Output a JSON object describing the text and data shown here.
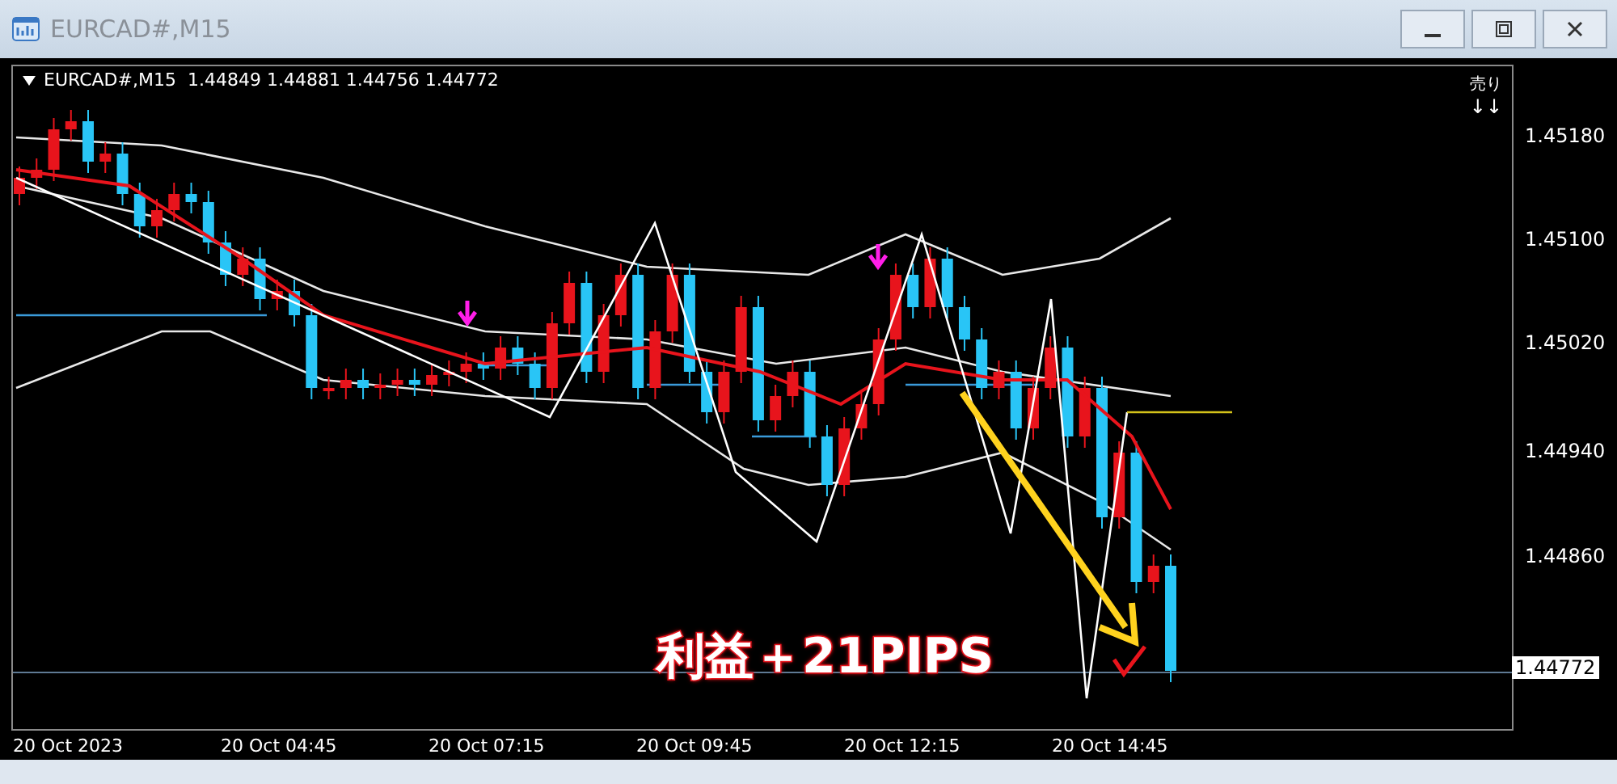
{
  "window": {
    "title": "EURCAD#,M15"
  },
  "chart": {
    "header": "EURCAD#,M15  1.44849 1.44881 1.44756 1.44772",
    "signal": {
      "label": "売り",
      "arrows": "↓↓"
    },
    "annotation": "利益＋21PIPS",
    "price_axis": [
      "1.45180",
      "1.45100",
      "1.45020",
      "1.44940",
      "1.44860"
    ],
    "current_price": "1.44772",
    "time_axis": [
      "20 Oct 2023",
      "20 Oct 04:45",
      "20 Oct 07:15",
      "20 Oct 09:45",
      "20 Oct 12:15",
      "20 Oct 14:45"
    ]
  }
}
